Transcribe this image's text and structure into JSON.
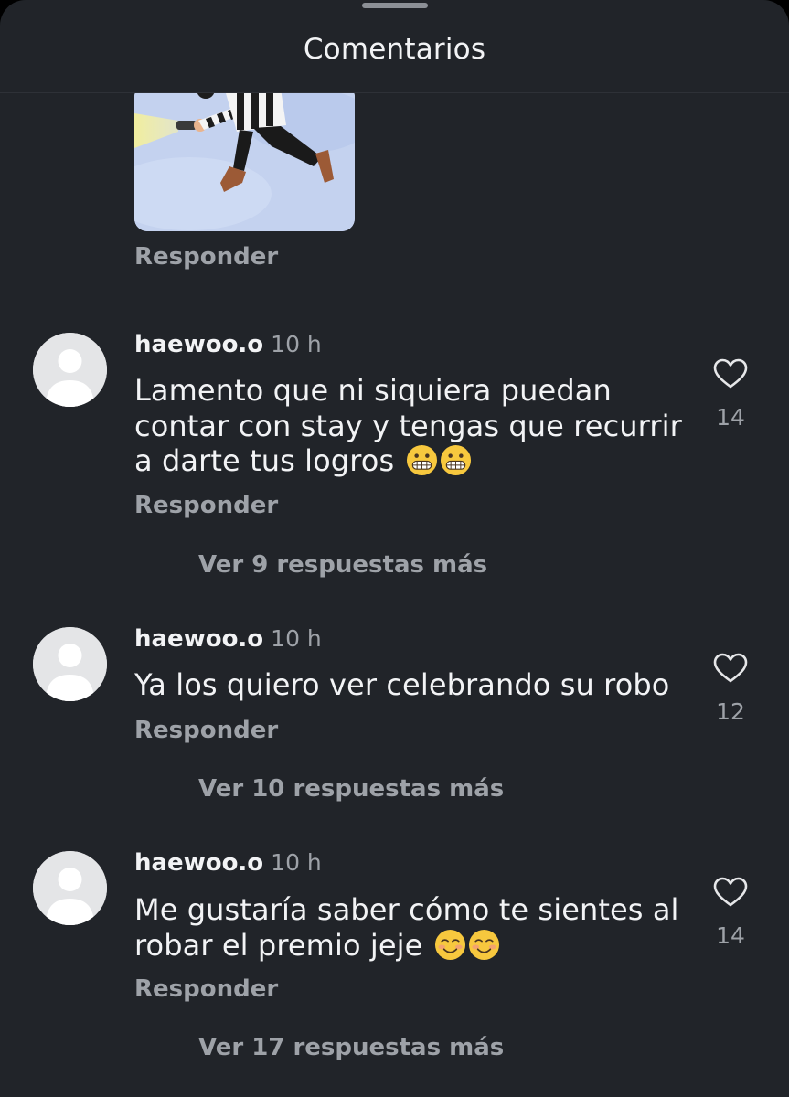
{
  "header": {
    "title": "Comentarios"
  },
  "attachment": {
    "reply_label": "Responder"
  },
  "comments": [
    {
      "username": "haewoo.o",
      "time": "10 h",
      "text": "Lamento que ni siquiera puedan contar con stay y tengas que recurrir a darte tus logros",
      "emoji": [
        "grimacing-face",
        "grimacing-face"
      ],
      "likes": "14",
      "reply_label": "Responder",
      "view_more": "Ver 9 respuestas más"
    },
    {
      "username": "haewoo.o",
      "time": "10 h",
      "text": "Ya los quiero ver celebrando su robo",
      "emoji": [],
      "likes": "12",
      "reply_label": "Responder",
      "view_more": "Ver 10 respuestas más"
    },
    {
      "username": "haewoo.o",
      "time": "10 h",
      "text": "Me gustaría saber cómo te sientes al robar el premio jeje",
      "emoji": [
        "smiling-face",
        "smiling-face"
      ],
      "likes": "14",
      "reply_label": "Responder",
      "view_more": "Ver 17 respuestas más"
    }
  ],
  "colors": {
    "background": "#212429",
    "primary_text": "#f2f3f5",
    "secondary_text": "#9ea2a8",
    "avatar_placeholder": "#e4e5e7"
  }
}
